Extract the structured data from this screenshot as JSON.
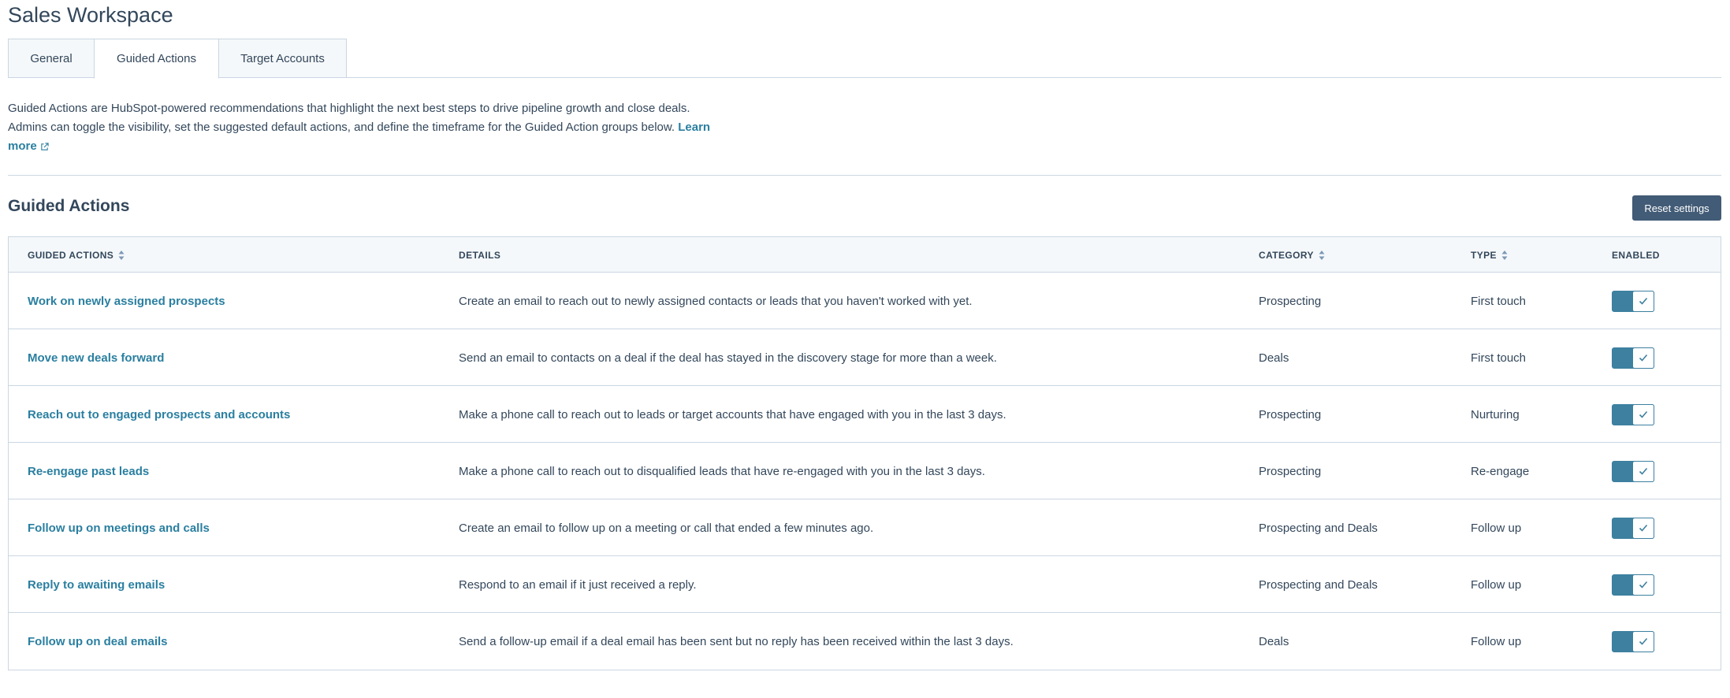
{
  "page": {
    "title": "Sales Workspace"
  },
  "tabs": [
    {
      "label": "General",
      "active": false
    },
    {
      "label": "Guided Actions",
      "active": true
    },
    {
      "label": "Target Accounts",
      "active": false
    }
  ],
  "description": {
    "line1": "Guided Actions are HubSpot-powered recommendations that highlight the next best steps to drive pipeline growth and close deals.",
    "line2": "Admins can toggle the visibility, set the suggested default actions, and define the timeframe for the Guided Action groups below.",
    "learn_more": "Learn more"
  },
  "section": {
    "title": "Guided Actions",
    "reset_label": "Reset settings"
  },
  "table": {
    "headers": {
      "action": "GUIDED ACTIONS",
      "details": "DETAILS",
      "category": "CATEGORY",
      "type": "TYPE",
      "enabled": "ENABLED"
    },
    "rows": [
      {
        "action": "Work on newly assigned prospects",
        "details": "Create an email to reach out to newly assigned contacts or leads that you haven't worked with yet.",
        "category": "Prospecting",
        "type": "First touch",
        "enabled": true
      },
      {
        "action": "Move new deals forward",
        "details": "Send an email to contacts on a deal if the deal has stayed in the discovery stage for more than a week.",
        "category": "Deals",
        "type": "First touch",
        "enabled": true
      },
      {
        "action": "Reach out to engaged prospects and accounts",
        "details": "Make a phone call to reach out to leads or target accounts that have engaged with you in the last 3 days.",
        "category": "Prospecting",
        "type": "Nurturing",
        "enabled": true
      },
      {
        "action": "Re-engage past leads",
        "details": "Make a phone call to reach out to disqualified leads that have re-engaged with you in the last 3 days.",
        "category": "Prospecting",
        "type": "Re-engage",
        "enabled": true
      },
      {
        "action": "Follow up on meetings and calls",
        "details": "Create an email to follow up on a meeting or call that ended a few minutes ago.",
        "category": "Prospecting and Deals",
        "type": "Follow up",
        "enabled": true
      },
      {
        "action": "Reply to awaiting emails",
        "details": "Respond to an email if it just received a reply.",
        "category": "Prospecting and Deals",
        "type": "Follow up",
        "enabled": true
      },
      {
        "action": "Follow up on deal emails",
        "details": "Send a follow-up email if a deal email has been sent but no reply has been received within the last 3 days.",
        "category": "Deals",
        "type": "Follow up",
        "enabled": true
      }
    ]
  },
  "colors": {
    "link": "#2a7fa0",
    "toggle_on": "#3d80a0",
    "button_bg": "#425b76",
    "text": "#33475b",
    "border": "#cbd6e2"
  },
  "icons": {
    "external_link": "external-link-icon",
    "sort": "sort-icon",
    "toggle_check": "check-icon"
  }
}
